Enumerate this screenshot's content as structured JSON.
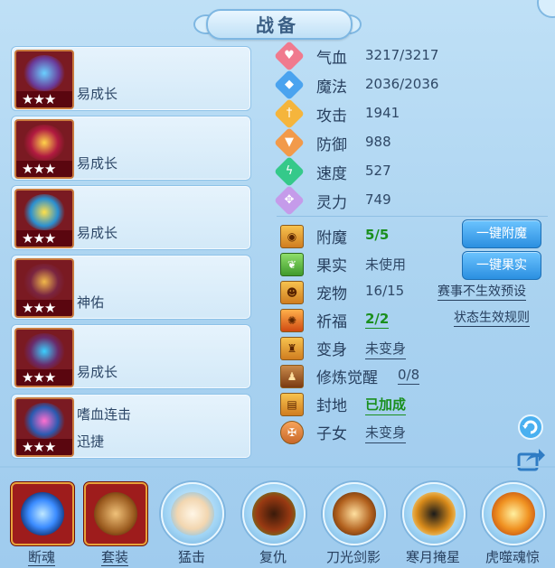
{
  "title": "战备",
  "equipment": [
    {
      "stars": "★★★",
      "labels": [
        "易成长"
      ]
    },
    {
      "stars": "★★★",
      "labels": [
        "易成长"
      ]
    },
    {
      "stars": "★★★",
      "labels": [
        "易成长"
      ]
    },
    {
      "stars": "★★★",
      "labels": [
        "神佑"
      ]
    },
    {
      "stars": "★★★",
      "labels": [
        "易成长"
      ]
    },
    {
      "stars": "★★★",
      "labels": [
        "嗜血连击",
        "迅捷"
      ]
    }
  ],
  "stats": [
    {
      "name": "气血",
      "value": "3217/3217",
      "icon": "heart-icon",
      "color": "#f07a8e"
    },
    {
      "name": "魔法",
      "value": "2036/2036",
      "icon": "mana-icon",
      "color": "#4aa3ef"
    },
    {
      "name": "攻击",
      "value": "1941",
      "icon": "attack-icon",
      "color": "#f5b53c"
    },
    {
      "name": "防御",
      "value": "988",
      "icon": "defense-icon",
      "color": "#f29a4a"
    },
    {
      "name": "速度",
      "value": "527",
      "icon": "speed-icon",
      "color": "#35c98a"
    },
    {
      "name": "灵力",
      "value": "749",
      "icon": "spirit-icon",
      "color": "#c59bea"
    }
  ],
  "attributes": [
    {
      "name": "附魔",
      "value": "5/5",
      "style": "green",
      "icon": "enchant-icon"
    },
    {
      "name": "果实",
      "value": "未使用",
      "style": "plain",
      "icon": "fruit-icon"
    },
    {
      "name": "宠物",
      "value": "16/15",
      "style": "plain",
      "icon": "pet-icon"
    },
    {
      "name": "祈福",
      "value": "2/2",
      "style": "green-ul",
      "icon": "blessing-icon"
    },
    {
      "name": "变身",
      "value": "未变身",
      "style": "ul",
      "icon": "transform-icon"
    },
    {
      "name": "修炼觉醒",
      "value": "0/8",
      "style": "ul",
      "icon": "cultivation-icon"
    },
    {
      "name": "封地",
      "value": "已加成",
      "style": "green-ul",
      "icon": "fief-icon"
    },
    {
      "name": "子女",
      "value": "未变身",
      "style": "ul",
      "icon": "children-icon"
    }
  ],
  "buttons": {
    "enchant_all": "一键附魔",
    "fruit_all": "一键果实"
  },
  "links": {
    "event_preset": "赛事不生效预设",
    "status_rules": "状态生效规则"
  },
  "skills": [
    {
      "name": "断魂",
      "frame": "square",
      "underline": true,
      "color": "#3b8cff"
    },
    {
      "name": "套装",
      "frame": "square",
      "underline": true,
      "color": "#c78a3c"
    },
    {
      "name": "猛击",
      "frame": "round",
      "underline": false,
      "color": "#f2d6b0"
    },
    {
      "name": "复仇",
      "frame": "round",
      "underline": false,
      "color": "#9a3a12"
    },
    {
      "name": "刀光剑影",
      "frame": "round",
      "underline": false,
      "color": "#b2611e"
    },
    {
      "name": "寒月掩星",
      "frame": "round",
      "underline": false,
      "color": "#d98b1a"
    },
    {
      "name": "虎噬魂惊",
      "frame": "round",
      "underline": false,
      "color": "#f09222"
    }
  ]
}
